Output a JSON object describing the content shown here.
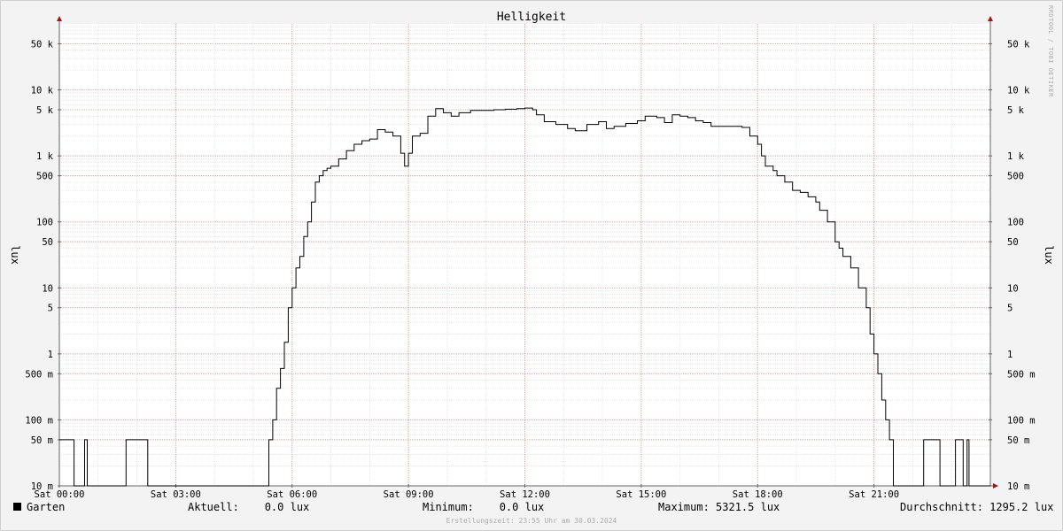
{
  "chart_data": {
    "type": "line",
    "title": "Helligkeit",
    "ylabel": "lux",
    "yscale": "log",
    "ylim": [
      0.01,
      100000
    ],
    "y_ticks": [
      {
        "v": 0.01,
        "label": "10 m"
      },
      {
        "v": 0.05,
        "label": "50 m"
      },
      {
        "v": 0.1,
        "label": "100 m"
      },
      {
        "v": 0.5,
        "label": "500 m"
      },
      {
        "v": 1,
        "label": "1"
      },
      {
        "v": 5,
        "label": "5"
      },
      {
        "v": 10,
        "label": "10"
      },
      {
        "v": 50,
        "label": "50"
      },
      {
        "v": 100,
        "label": "100"
      },
      {
        "v": 500,
        "label": "500"
      },
      {
        "v": 1000,
        "label": "1 k"
      },
      {
        "v": 5000,
        "label": "5 k"
      },
      {
        "v": 10000,
        "label": "10 k"
      },
      {
        "v": 50000,
        "label": "50 k"
      }
    ],
    "x_ticks": [
      {
        "h": 0,
        "label": "Sat 00:00"
      },
      {
        "h": 3,
        "label": "Sat 03:00"
      },
      {
        "h": 6,
        "label": "Sat 06:00"
      },
      {
        "h": 9,
        "label": "Sat 09:00"
      },
      {
        "h": 12,
        "label": "Sat 12:00"
      },
      {
        "h": 15,
        "label": "Sat 15:00"
      },
      {
        "h": 18,
        "label": "Sat 18:00"
      },
      {
        "h": 21,
        "label": "Sat 21:00"
      }
    ],
    "xlim_hours": [
      0,
      24
    ],
    "grid": true,
    "series": [
      {
        "name": "Garten",
        "color": "#000000",
        "points": [
          [
            0.0,
            0.05
          ],
          [
            0.38,
            0.05
          ],
          [
            0.38,
            0.01
          ],
          [
            0.65,
            0.01
          ],
          [
            0.65,
            0.05
          ],
          [
            0.72,
            0.05
          ],
          [
            0.72,
            0.01
          ],
          [
            1.72,
            0.01
          ],
          [
            1.72,
            0.05
          ],
          [
            2.28,
            0.05
          ],
          [
            2.28,
            0.01
          ],
          [
            5.4,
            0.01
          ],
          [
            5.4,
            0.05
          ],
          [
            5.5,
            0.1
          ],
          [
            5.6,
            0.3
          ],
          [
            5.7,
            0.6
          ],
          [
            5.8,
            1.5
          ],
          [
            5.9,
            5
          ],
          [
            6.0,
            10
          ],
          [
            6.1,
            20
          ],
          [
            6.2,
            30
          ],
          [
            6.3,
            60
          ],
          [
            6.4,
            100
          ],
          [
            6.5,
            200
          ],
          [
            6.6,
            400
          ],
          [
            6.7,
            500
          ],
          [
            6.8,
            600
          ],
          [
            6.9,
            650
          ],
          [
            7.0,
            700
          ],
          [
            7.2,
            900
          ],
          [
            7.4,
            1200
          ],
          [
            7.6,
            1500
          ],
          [
            7.8,
            1700
          ],
          [
            8.0,
            1800
          ],
          [
            8.2,
            2500
          ],
          [
            8.4,
            2300
          ],
          [
            8.6,
            2000
          ],
          [
            8.8,
            1100
          ],
          [
            8.9,
            700
          ],
          [
            9.0,
            1100
          ],
          [
            9.1,
            2000
          ],
          [
            9.3,
            2200
          ],
          [
            9.5,
            4000
          ],
          [
            9.7,
            5200
          ],
          [
            9.9,
            4500
          ],
          [
            10.1,
            4000
          ],
          [
            10.3,
            4500
          ],
          [
            10.6,
            4900
          ],
          [
            10.9,
            4900
          ],
          [
            11.2,
            5000
          ],
          [
            11.5,
            5100
          ],
          [
            11.8,
            5200
          ],
          [
            12.0,
            5300
          ],
          [
            12.2,
            5000
          ],
          [
            12.3,
            4200
          ],
          [
            12.5,
            3300
          ],
          [
            12.8,
            3000
          ],
          [
            13.1,
            2600
          ],
          [
            13.3,
            2400
          ],
          [
            13.6,
            3000
          ],
          [
            13.9,
            3300
          ],
          [
            14.1,
            2600
          ],
          [
            14.3,
            2800
          ],
          [
            14.6,
            3100
          ],
          [
            14.9,
            3400
          ],
          [
            15.1,
            4000
          ],
          [
            15.4,
            3800
          ],
          [
            15.6,
            3200
          ],
          [
            15.8,
            4200
          ],
          [
            16.0,
            4000
          ],
          [
            16.2,
            3800
          ],
          [
            16.4,
            3400
          ],
          [
            16.6,
            3200
          ],
          [
            16.8,
            2800
          ],
          [
            17.2,
            2800
          ],
          [
            17.6,
            2700
          ],
          [
            17.8,
            2000
          ],
          [
            18.0,
            1500
          ],
          [
            18.1,
            1000
          ],
          [
            18.2,
            700
          ],
          [
            18.4,
            600
          ],
          [
            18.5,
            500
          ],
          [
            18.7,
            400
          ],
          [
            18.9,
            300
          ],
          [
            19.1,
            280
          ],
          [
            19.3,
            240
          ],
          [
            19.5,
            200
          ],
          [
            19.6,
            150
          ],
          [
            19.8,
            100
          ],
          [
            20.0,
            50
          ],
          [
            20.1,
            40
          ],
          [
            20.2,
            30
          ],
          [
            20.4,
            20
          ],
          [
            20.6,
            10
          ],
          [
            20.8,
            5
          ],
          [
            20.9,
            2
          ],
          [
            21.0,
            1
          ],
          [
            21.1,
            0.5
          ],
          [
            21.2,
            0.2
          ],
          [
            21.3,
            0.1
          ],
          [
            21.4,
            0.05
          ],
          [
            21.5,
            0.05
          ],
          [
            21.5,
            0.01
          ],
          [
            22.28,
            0.01
          ],
          [
            22.28,
            0.05
          ],
          [
            22.7,
            0.05
          ],
          [
            22.7,
            0.01
          ],
          [
            23.1,
            0.01
          ],
          [
            23.1,
            0.05
          ],
          [
            23.3,
            0.05
          ],
          [
            23.3,
            0.01
          ],
          [
            23.4,
            0.01
          ],
          [
            23.4,
            0.05
          ],
          [
            23.45,
            0.05
          ],
          [
            23.45,
            0.01
          ],
          [
            24.0,
            0.01
          ]
        ]
      }
    ]
  },
  "legend": {
    "series_label": "Garten",
    "current": "Aktuell:    0.0 lux",
    "minimum": "Minimum:    0.0 lux",
    "maximum": "Maximum: 5321.5 lux",
    "average": "Durchschnitt: 1295.2 lux"
  },
  "footer": "Erstellungszeit: 23:55 Uhr am 30.03.2024",
  "watermark": "RRDTOOL / TOBI OETIKER",
  "colors": {
    "grid_major": "#e8a5a5",
    "grid_minor": "#e6e6e6",
    "line": "#000000",
    "background": "#f3f3f3",
    "plot_bg": "#ffffff"
  }
}
